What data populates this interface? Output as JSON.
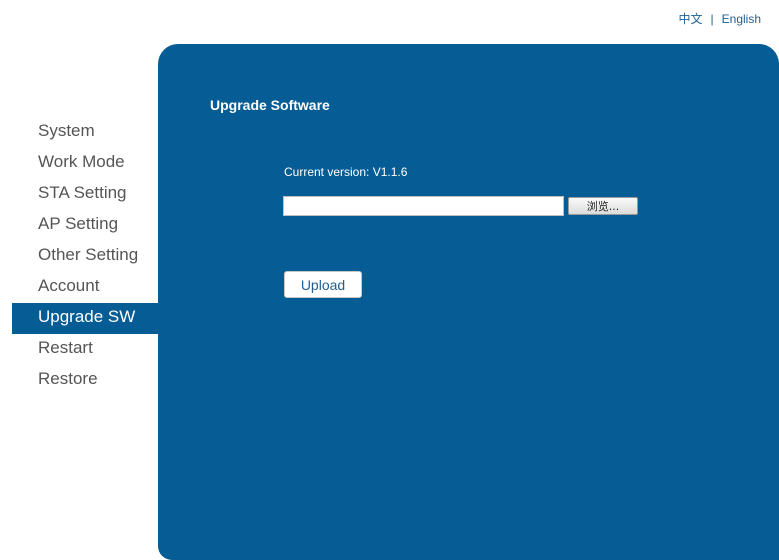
{
  "language": {
    "chinese": "中文",
    "separator": "|",
    "english": "English"
  },
  "sidebar": {
    "items": [
      {
        "label": "System"
      },
      {
        "label": "Work Mode"
      },
      {
        "label": "STA Setting"
      },
      {
        "label": "AP Setting"
      },
      {
        "label": "Other Setting"
      },
      {
        "label": "Account"
      },
      {
        "label": "Upgrade SW",
        "active": true
      },
      {
        "label": "Restart"
      },
      {
        "label": "Restore"
      }
    ]
  },
  "main": {
    "title": "Upgrade Software",
    "version_text": "Current version: V1.1.6",
    "file_input": {
      "value": ""
    },
    "browse_label": "浏览...",
    "upload_label": "Upload"
  },
  "colors": {
    "panel": "#065c94",
    "active_nav": "#065c94",
    "link": "#1f5f94"
  }
}
